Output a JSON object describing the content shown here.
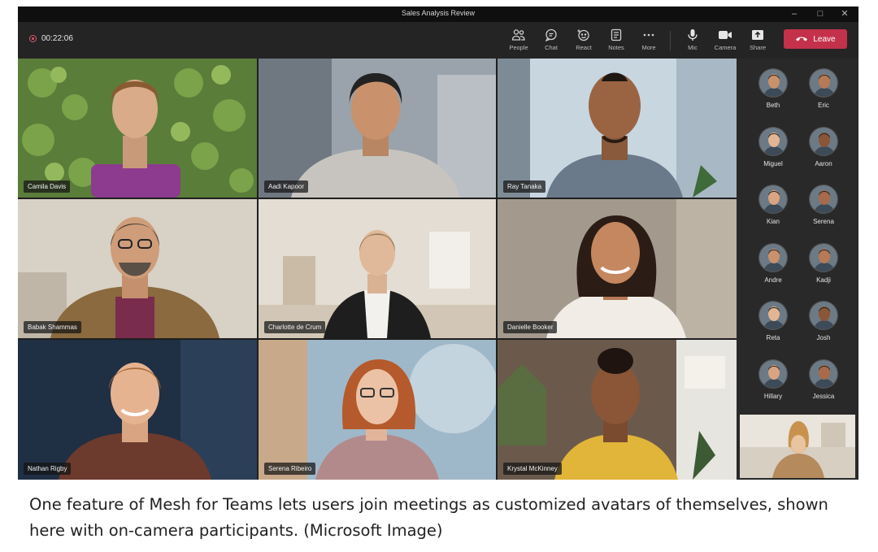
{
  "window": {
    "title": "Sales Analysis Review",
    "controls": [
      "–",
      "□",
      "✕"
    ]
  },
  "toolbar": {
    "timer": "00:22:06",
    "buttons": [
      {
        "label": "People",
        "icon": "people-icon"
      },
      {
        "label": "Chat",
        "icon": "chat-icon"
      },
      {
        "label": "React",
        "icon": "react-icon"
      },
      {
        "label": "Notes",
        "icon": "notes-icon"
      },
      {
        "label": "More",
        "icon": "more-icon"
      },
      {
        "label": "Mic",
        "icon": "mic-icon"
      },
      {
        "label": "Camera",
        "icon": "camera-icon"
      },
      {
        "label": "Share",
        "icon": "share-icon"
      }
    ],
    "leave_label": "Leave",
    "leave_color": "#c4314b"
  },
  "tiles": [
    {
      "name": "Camila Davis"
    },
    {
      "name": "Aadi Kapoor"
    },
    {
      "name": "Ray Tanaka"
    },
    {
      "name": "Babak Shammas"
    },
    {
      "name": "Charlotte de Crum"
    },
    {
      "name": "Danielle Booker"
    },
    {
      "name": "Nathan Rigby"
    },
    {
      "name": "Serena Ribeiro"
    },
    {
      "name": "Krystal McKinney"
    }
  ],
  "participants": [
    {
      "name": "Beth"
    },
    {
      "name": "Eric"
    },
    {
      "name": "Miguel"
    },
    {
      "name": "Aaron"
    },
    {
      "name": "Kian"
    },
    {
      "name": "Serena"
    },
    {
      "name": "Andre"
    },
    {
      "name": "Kadji"
    },
    {
      "name": "Reta"
    },
    {
      "name": "Josh"
    },
    {
      "name": "Hillary"
    },
    {
      "name": "Jessica"
    }
  ],
  "caption": "One feature of Mesh for Teams lets users join meetings as customized avatars of themselves, shown here with on-camera participants. (Microsoft Image)"
}
